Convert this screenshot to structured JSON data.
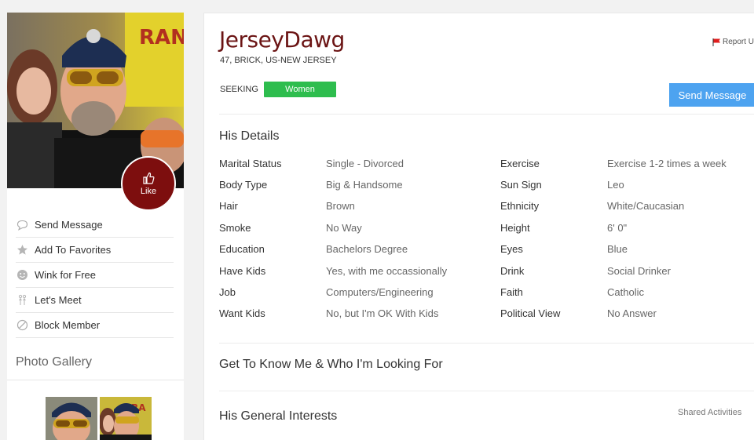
{
  "profile": {
    "username": "JerseyDawg",
    "subline": "47, BRICK, US-NEW JERSEY",
    "seeking_label": "SEEKING",
    "seeking_value": "Women",
    "report_label": "Report U",
    "like_label": "Like",
    "send_message_button": "Send Message"
  },
  "actions": [
    {
      "label": "Send Message",
      "icon": "speech-bubble-icon"
    },
    {
      "label": "Add To Favorites",
      "icon": "star-icon"
    },
    {
      "label": "Wink for Free",
      "icon": "smiley-icon"
    },
    {
      "label": "Let's Meet",
      "icon": "people-icon"
    },
    {
      "label": "Block Member",
      "icon": "block-icon"
    }
  ],
  "gallery": {
    "title": "Photo Gallery"
  },
  "details": {
    "title": "His Details",
    "left": [
      {
        "label": "Marital Status",
        "value": "Single - Divorced"
      },
      {
        "label": "Body Type",
        "value": "Big & Handsome"
      },
      {
        "label": "Hair",
        "value": "Brown"
      },
      {
        "label": "Smoke",
        "value": "No Way"
      },
      {
        "label": "Education",
        "value": "Bachelors Degree"
      },
      {
        "label": "Have Kids",
        "value": "Yes, with me occassionally"
      },
      {
        "label": "Job",
        "value": "Computers/Engineering"
      },
      {
        "label": "Want Kids",
        "value": "No, but I'm OK With Kids"
      }
    ],
    "right": [
      {
        "label": "Exercise",
        "value": "Exercise 1-2 times a week"
      },
      {
        "label": "Sun Sign",
        "value": "Leo"
      },
      {
        "label": "Ethnicity",
        "value": "White/Caucasian"
      },
      {
        "label": "Height",
        "value": "6' 0\""
      },
      {
        "label": "Eyes",
        "value": "Blue"
      },
      {
        "label": "Drink",
        "value": "Social Drinker"
      },
      {
        "label": "Faith",
        "value": "Catholic"
      },
      {
        "label": "Political View",
        "value": "No Answer"
      }
    ]
  },
  "sections": {
    "know_me": "Get To Know Me & Who I'm Looking For",
    "interests": "His General Interests",
    "shared_activities": "Shared Activities"
  },
  "colors": {
    "username": "#6b1414",
    "like_button": "#7d0e0e",
    "seeking_badge": "#2ebd4e",
    "send_button": "#4da3f0"
  }
}
